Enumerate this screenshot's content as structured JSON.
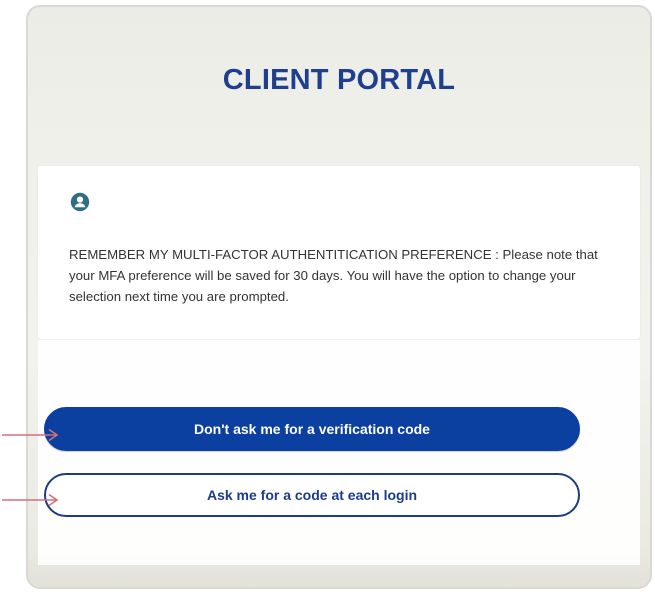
{
  "portal": {
    "title": "CLIENT PORTAL"
  },
  "notice": {
    "icon": "user-circle-icon",
    "text": "REMEMBER MY MULTI-FACTOR AUTHENTITICATION PREFERENCE : Please note that your MFA preference will be saved for 30 days. You will have the option to change your selection next time you are prompted."
  },
  "actions": {
    "primary_label": "Don't ask me for a verification code",
    "secondary_label": "Ask me for a code at each login"
  },
  "annotations": {
    "arrow_icon": "right-arrow-icon",
    "arrow_color": "#d4707a"
  },
  "colors": {
    "brand_blue": "#1f3e8e",
    "primary_button": "#0b3fa0",
    "icon_teal": "#2f6f86"
  }
}
